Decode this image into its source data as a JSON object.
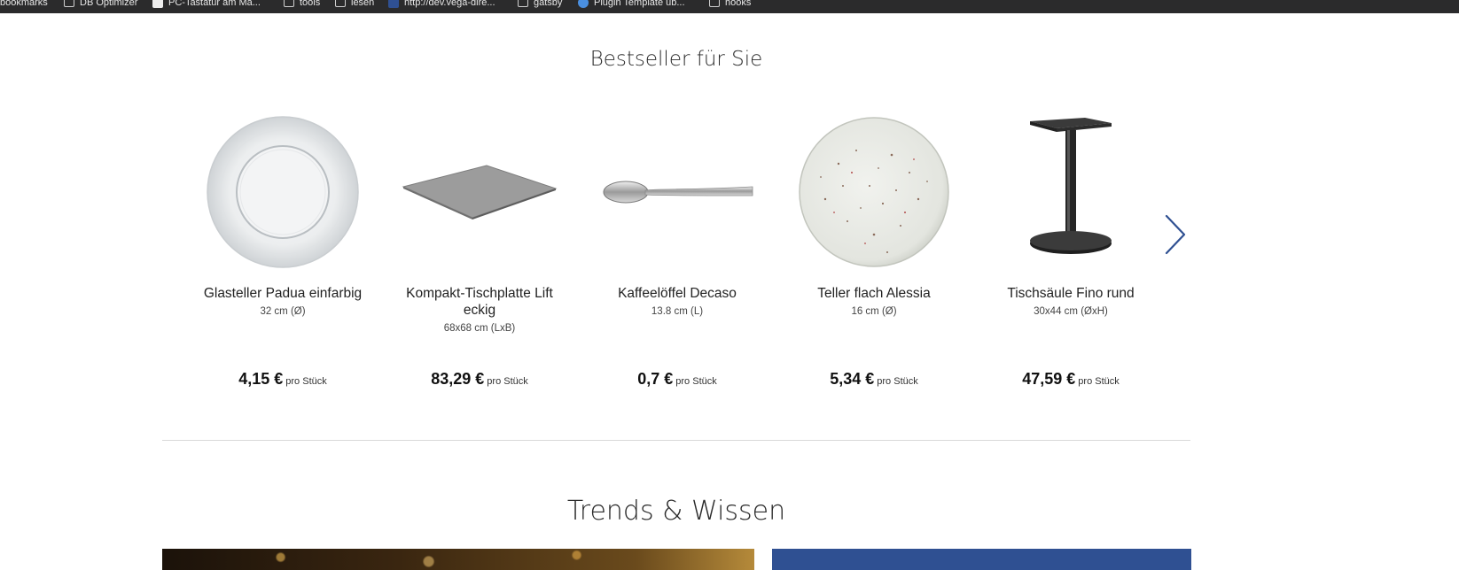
{
  "bookmarks": [
    {
      "label": "bookmarks",
      "type": "folder"
    },
    {
      "label": "DB Optimizer",
      "type": "folder"
    },
    {
      "label": "PC-Tastatur am Ma...",
      "type": "site"
    },
    {
      "label": "tools",
      "type": "folder"
    },
    {
      "label": "lesen",
      "type": "folder"
    },
    {
      "label": "http://dev.vega-dire...",
      "type": "site"
    },
    {
      "label": "gatsby",
      "type": "folder"
    },
    {
      "label": "Plugin Template ub...",
      "type": "site"
    },
    {
      "label": "hooks",
      "type": "folder"
    }
  ],
  "bestseller": {
    "title": "Bestseller für Sie",
    "products": [
      {
        "name": "Glasteller Padua einfarbig",
        "size": "32 cm (Ø)",
        "price": "4,15 €",
        "unit": "pro Stück",
        "icon": "glass-plate-image"
      },
      {
        "name": "Kompakt-Tischplatte Lift eckig",
        "size": "68x68 cm (LxB)",
        "price": "83,29 €",
        "unit": "pro Stück",
        "icon": "table-top-image"
      },
      {
        "name": "Kaffeelöffel Decaso",
        "size": "13.8 cm (L)",
        "price": "0,7 €",
        "unit": "pro Stück",
        "icon": "spoon-image"
      },
      {
        "name": "Teller flach Alessia",
        "size": "16 cm (Ø)",
        "price": "5,34 €",
        "unit": "pro Stück",
        "icon": "speckled-plate-image"
      },
      {
        "name": "Tischsäule Fino rund",
        "size": "30x44 cm (ØxH)",
        "price": "47,59 €",
        "unit": "pro Stück",
        "icon": "table-base-image"
      }
    ],
    "next_icon": "chevron-right-icon"
  },
  "trends": {
    "title": "Trends & Wissen"
  },
  "colors": {
    "accent": "#2f5092",
    "bookmarks_bar": "#2b2b2c"
  }
}
